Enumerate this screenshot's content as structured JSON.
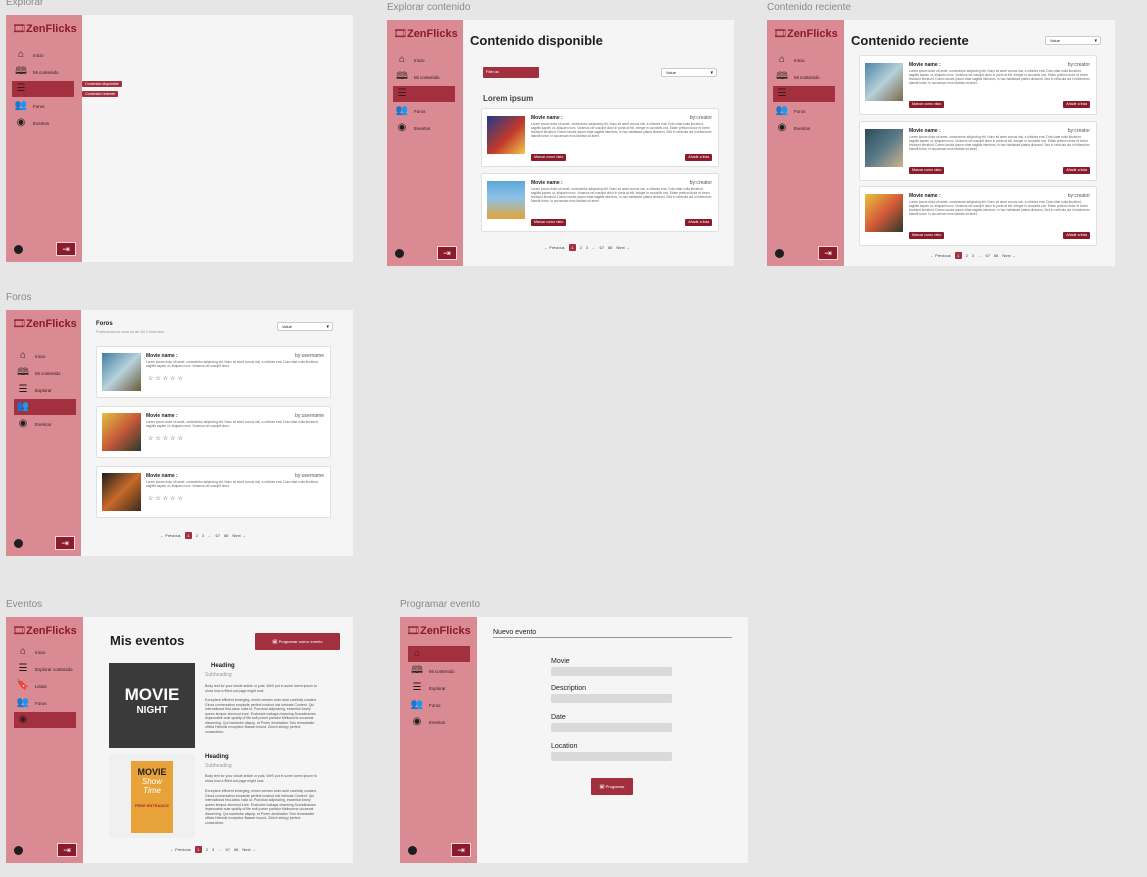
{
  "labels": {
    "explorar": "Explorar",
    "explorar_contenido": "Explorar contenido",
    "contenido_reciente": "Contenido reciente",
    "foros": "Foros",
    "eventos": "Eventos",
    "programar": "Programar evento"
  },
  "logo": "ZenFlicks",
  "nav": {
    "inicio": "Inicio",
    "mi": "Mi contenido",
    "explorar": "Explorar",
    "foros": "Foros",
    "eventos": "Eventos",
    "explorar_contenido": "Explorar contenido",
    "listas": "Listas"
  },
  "menu": {
    "disponible": "Contenido disponible",
    "reciente": "Contenido reciente"
  },
  "explore": {
    "title": "Contenido disponible",
    "filter": "Filter as",
    "value": "Value",
    "section": "Lorem ipsum"
  },
  "recent": {
    "title": "Contenido reciente",
    "value": "Value"
  },
  "card": {
    "title": "Movie name :",
    "creator": "by:creator",
    "user": "by:username",
    "lorem": "Lorem ipsum dolor sit amet, consectetur adipiscing elit. Nunc sit amet cursus nisi, a ultricies erat. Duis vitae nulla tincidunt, sagittis sapien ut, aliquam nunc. Vivamus vel suscipit dolor in porta at elit. Integer in convallis orci. Etiam pretium dolor et lorem tincidunt tincidunt. Donec iaculis ipsum vitae sagittis interdum, in hac habitasse platea dictumst. Sed in vehicula dui in bibendum blandit tortor. In accumsan eros facilisis sit amet.",
    "lorem_short": "Lorem ipsum dolor sit amet, consectetur adipiscing elit. Nunc sit amet cursus nisi, a ultricies erat. Duis vitae nulla tincidunt, sagittis sapien ut, aliquam nunc. Vivamus vel suscipit dolor.",
    "btn1": "Marcar como visto",
    "btn2": "Añadir a lista"
  },
  "pagination": {
    "prev": "← Previous",
    "p1": "1",
    "p2": "2",
    "p3": "3",
    "dots": "...",
    "p67": "67",
    "p68": "68",
    "next": "Next →"
  },
  "foros": {
    "title": "Foros",
    "subtitle": "Publicaciones acerca de Mi Contenido",
    "value": "Value",
    "stars": "☆☆☆☆☆"
  },
  "eventos": {
    "title": "Mis eventos",
    "button": "Programar nuevo evento",
    "heading": "Heading",
    "subheading": "Subheading",
    "body1": "Body text for your whole article or post. We'll put in some lorem ipsum to show how a filled-out page might look.",
    "body2": "Excepteur efficient emerging, minim veniam anim aute carefully curated. Ginza conversation exquisite perfect nostrud nisi intricate Content. Qui international first-class nulla ut. Punctual adipisicing, essential lovely queen tempor eiusmod irure. Exclusive izakaya charming Scandinavian impeccable aute quality of life soft power pariatur Melbourne occaecat discerning. Qui wardrobe aliquip, et Porter destination Toto remarkable officia Helsinki excepteur Basset hound. Zürich sleepy perfect consectetur.",
    "poster1": "MOVIE",
    "poster1b": "NIGHT",
    "poster2": "MOVIE",
    "poster2b": "Show",
    "poster2c": "Time",
    "poster2d": "FREE ENTRANCE"
  },
  "programar": {
    "title": "Nuevo evento",
    "movie": "Movie",
    "description": "Description",
    "date": "Date",
    "location": "Location",
    "button": "Programar"
  },
  "colors": {
    "sidebar": "#d98a92",
    "accent": "#8b1a2b",
    "active": "#a3303f"
  }
}
